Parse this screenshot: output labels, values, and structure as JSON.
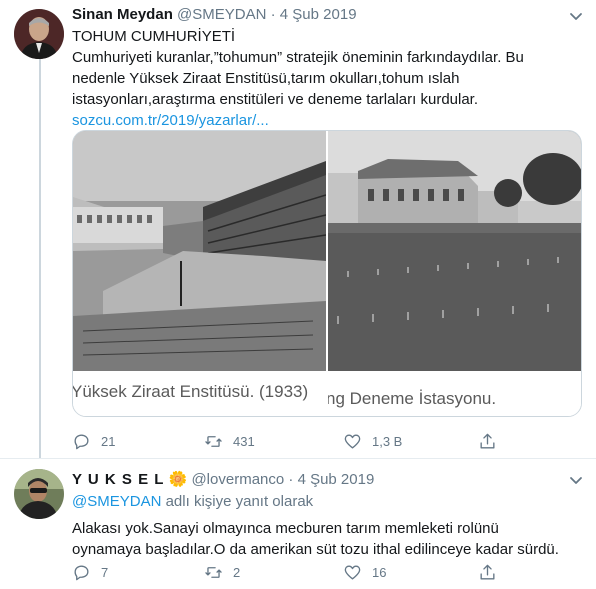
{
  "tweet1": {
    "author_name": "Sinan Meydan",
    "handle": "@SMEYDAN",
    "separator": "·",
    "date": "4 Şub 2019",
    "title": "TOHUM CUMHURİYETİ",
    "body": "Cumhuriyeti kuranlar,”tohumun” stratejik öneminin farkındaydılar. Bu nedenle Yüksek Ziraat Enstitüsü,tarım okulları,tohum ıslah istasyonları,araştırma enstitüleri ve deneme tarlaları kurdular.",
    "link": "sozcu.com.tr/2019/yazarlar/...",
    "photo_left_caption": "Yüksek Ziraat Enstitüsü. (1933)",
    "photo_right_caption": "ng Deneme İstasyonu.",
    "replies": "21",
    "retweets": "431",
    "likes": "1,3 B"
  },
  "tweet2": {
    "author_name": "Y U K S E L",
    "author_emoji": "🌼",
    "handle": "@lovermanco",
    "separator": "·",
    "date": "4 Şub 2019",
    "reply_mention": "@SMEYDAN",
    "reply_suffix": "adlı kişiye yanıt olarak",
    "body": "Alakası yok.Sanayi olmayınca mecburen tarım memleketi rolünü oynamaya başladılar.O da amerikan süt tozu ithal edilinceye kadar sürdü.",
    "replies": "7",
    "retweets": "2",
    "likes": "16"
  },
  "icons": [
    "chevron-down-icon",
    "reply-icon",
    "retweet-icon",
    "like-icon",
    "share-icon",
    "flower-emoji"
  ],
  "colors": {
    "link": "#1b95e0",
    "muted": "#657786",
    "border": "#ccd6dd"
  }
}
